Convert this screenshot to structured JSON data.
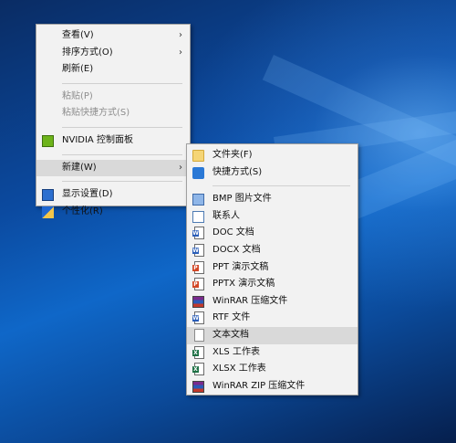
{
  "main_menu": {
    "items": [
      {
        "label": "查看(V)",
        "submenu": true,
        "disabled": false
      },
      {
        "label": "排序方式(O)",
        "submenu": true,
        "disabled": false
      },
      {
        "label": "刷新(E)",
        "submenu": false,
        "disabled": false
      },
      {
        "label": "粘贴(P)",
        "submenu": false,
        "disabled": true
      },
      {
        "label": "粘贴快捷方式(S)",
        "submenu": false,
        "disabled": true
      },
      {
        "label": "NVIDIA 控制面板",
        "icon": "nvidia-icon"
      },
      {
        "label": "新建(W)",
        "submenu": true,
        "highlight": true
      },
      {
        "label": "显示设置(D)",
        "icon": "display-settings-icon"
      },
      {
        "label": "个性化(R)",
        "icon": "personalize-icon"
      }
    ]
  },
  "new_submenu": {
    "items": [
      {
        "label": "文件夹(F)",
        "icon": "folder-icon"
      },
      {
        "label": "快捷方式(S)",
        "icon": "shortcut-icon"
      },
      {
        "label": "BMP 图片文件",
        "icon": "bmp-file-icon"
      },
      {
        "label": "联系人",
        "icon": "contact-icon"
      },
      {
        "label": "DOC 文档",
        "icon": "doc-file-icon"
      },
      {
        "label": "DOCX 文档",
        "icon": "docx-file-icon"
      },
      {
        "label": "PPT 演示文稿",
        "icon": "ppt-file-icon"
      },
      {
        "label": "PPTX 演示文稿",
        "icon": "pptx-file-icon"
      },
      {
        "label": "WinRAR 压缩文件",
        "icon": "winrar-icon"
      },
      {
        "label": "RTF 文件",
        "icon": "rtf-file-icon"
      },
      {
        "label": "文本文档",
        "icon": "text-file-icon",
        "highlight": true
      },
      {
        "label": "XLS 工作表",
        "icon": "xls-file-icon"
      },
      {
        "label": "XLSX 工作表",
        "icon": "xlsx-file-icon"
      },
      {
        "label": "WinRAR ZIP 压缩文件",
        "icon": "winrar-zip-icon"
      }
    ]
  },
  "arrow_glyph": "›",
  "tags": {
    "doc": "W",
    "ppt": "P",
    "xls": "X",
    "rtf": "W"
  },
  "colors": {
    "word": "#2b5eb8",
    "ppt": "#d24726",
    "excel": "#1e7145",
    "highlight": "#d9d9d9"
  }
}
